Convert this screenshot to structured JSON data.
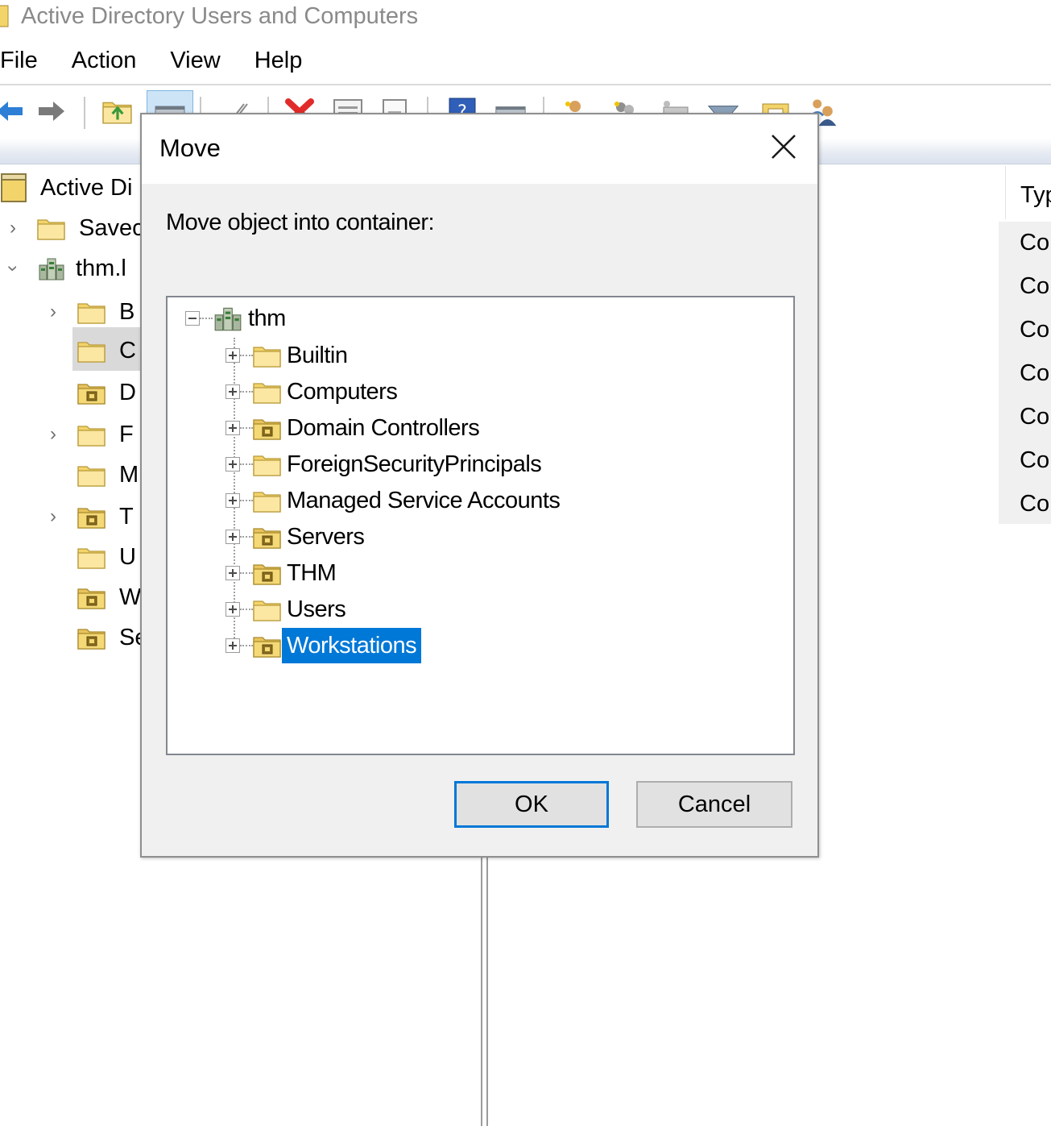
{
  "window": {
    "title": "Active Directory Users and Computers",
    "menu": [
      "File",
      "Action",
      "View",
      "Help"
    ]
  },
  "colors": {
    "accent": "#0078d7",
    "folder": "#f5d977",
    "dialog_bg": "#f0f0f0"
  },
  "left_tree": {
    "root_label": "Active Di",
    "items": [
      {
        "label": "Savec",
        "icon": "folder-icon"
      },
      {
        "label": "thm.l",
        "icon": "domain-icon"
      },
      {
        "label": "B",
        "icon": "folder-icon"
      },
      {
        "label": "C",
        "icon": "folder-icon"
      },
      {
        "label": "D",
        "icon": "ou-folder-icon"
      },
      {
        "label": "F",
        "icon": "folder-icon"
      },
      {
        "label": "M",
        "icon": "folder-icon"
      },
      {
        "label": "T",
        "icon": "ou-folder-icon"
      },
      {
        "label": "U",
        "icon": "folder-icon"
      },
      {
        "label": "W",
        "icon": "ou-folder-icon"
      },
      {
        "label": "Se",
        "icon": "ou-folder-icon"
      }
    ]
  },
  "right_list": {
    "column_header": "Typ",
    "rows": [
      "Co",
      "Co",
      "Co",
      "Co",
      "Co",
      "Co",
      "Co"
    ]
  },
  "dialog": {
    "title": "Move",
    "prompt": "Move object into container:",
    "tree": {
      "root": "thm",
      "children": [
        {
          "label": "Builtin",
          "icon": "folder-icon"
        },
        {
          "label": "Computers",
          "icon": "folder-icon"
        },
        {
          "label": "Domain Controllers",
          "icon": "ou-folder-icon"
        },
        {
          "label": "ForeignSecurityPrincipals",
          "icon": "folder-icon"
        },
        {
          "label": "Managed Service Accounts",
          "icon": "folder-icon"
        },
        {
          "label": "Servers",
          "icon": "ou-folder-icon"
        },
        {
          "label": "THM",
          "icon": "ou-folder-icon"
        },
        {
          "label": "Users",
          "icon": "folder-icon"
        },
        {
          "label": "Workstations",
          "icon": "ou-folder-icon",
          "selected": true
        }
      ]
    },
    "ok_label": "OK",
    "cancel_label": "Cancel"
  }
}
